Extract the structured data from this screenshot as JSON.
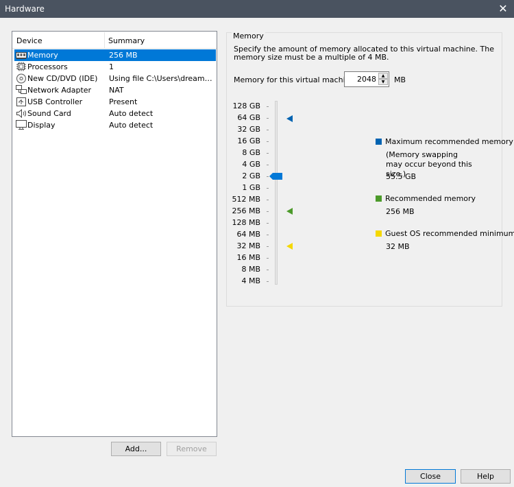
{
  "window": {
    "title": "Hardware"
  },
  "device_list": {
    "columns": [
      "Device",
      "Summary"
    ],
    "rows": [
      {
        "device": "Memory",
        "summary": "256 MB",
        "icon": "memory-icon",
        "selected": true
      },
      {
        "device": "Processors",
        "summary": "1",
        "icon": "processor-icon"
      },
      {
        "device": "New CD/DVD (IDE)",
        "summary": "Using file C:\\Users\\dreamWe...",
        "icon": "cd-dvd-icon"
      },
      {
        "device": "Network Adapter",
        "summary": "NAT",
        "icon": "network-adapter-icon"
      },
      {
        "device": "USB Controller",
        "summary": "Present",
        "icon": "usb-icon"
      },
      {
        "device": "Sound Card",
        "summary": "Auto detect",
        "icon": "speaker-icon"
      },
      {
        "device": "Display",
        "summary": "Auto detect",
        "icon": "display-icon"
      }
    ]
  },
  "buttons": {
    "add": "Add...",
    "remove": "Remove",
    "close": "Close",
    "help": "Help"
  },
  "memory": {
    "group_title": "Memory",
    "description": "Specify the amount of memory allocated to this virtual machine. The memory size must be a multiple of 4 MB.",
    "field_label": "Memory for this virtual machine:",
    "value": "2048",
    "unit": "MB",
    "scale_labels": [
      "128 GB",
      "64 GB",
      "32 GB",
      "16 GB",
      "8 GB",
      "4 GB",
      "2 GB",
      "1 GB",
      "512 MB",
      "256 MB",
      "128 MB",
      "64 MB",
      "32 MB",
      "16 MB",
      "8 MB",
      "4 MB"
    ],
    "legend": {
      "maximum": {
        "label": "Maximum recommended memory",
        "note": "(Memory swapping may occur beyond this size.)",
        "value": "55.5 GB",
        "color": "#0063b1"
      },
      "recommended": {
        "label": "Recommended memory",
        "value": "256 MB",
        "color": "#4c9a2a"
      },
      "minimum": {
        "label": "Guest OS recommended minimum",
        "value": "32 MB",
        "color": "#f5d800"
      }
    },
    "slider_accent": "#0078d7"
  }
}
